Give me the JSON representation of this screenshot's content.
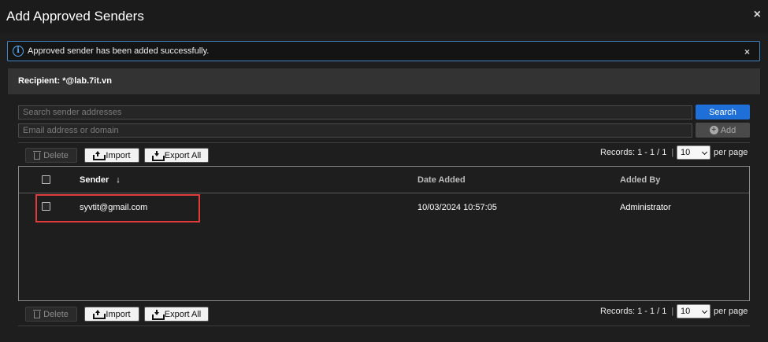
{
  "dialog": {
    "title": "Add Approved Senders",
    "close": "×"
  },
  "alert": {
    "message": "Approved sender has been added successfully.",
    "close": "×",
    "icon": "info-icon"
  },
  "recipient": {
    "label": "Recipient: *@lab.7it.vn"
  },
  "search": {
    "placeholder": "Search sender addresses",
    "button": "Search"
  },
  "add": {
    "placeholder": "Email address or domain",
    "button": "Add"
  },
  "toolbar": {
    "delete": "Delete",
    "import": "Import",
    "export": "Export All",
    "records": "Records: 1 - 1 / 1",
    "separator": "|",
    "per_page_value": "10",
    "per_page_label": "per page"
  },
  "table": {
    "columns": {
      "sender": "Sender",
      "sort_arrow": "↓",
      "date_added": "Date Added",
      "added_by": "Added By"
    },
    "rows": [
      {
        "sender": "syvtit@gmail.com",
        "date_added": "10/03/2024 10:57:05",
        "added_by": "Administrator"
      }
    ]
  },
  "colors": {
    "background": "#1e1e1e",
    "accent": "#1f6fd9",
    "alert_border": "#3f86c9",
    "highlight": "#e03b3b"
  }
}
